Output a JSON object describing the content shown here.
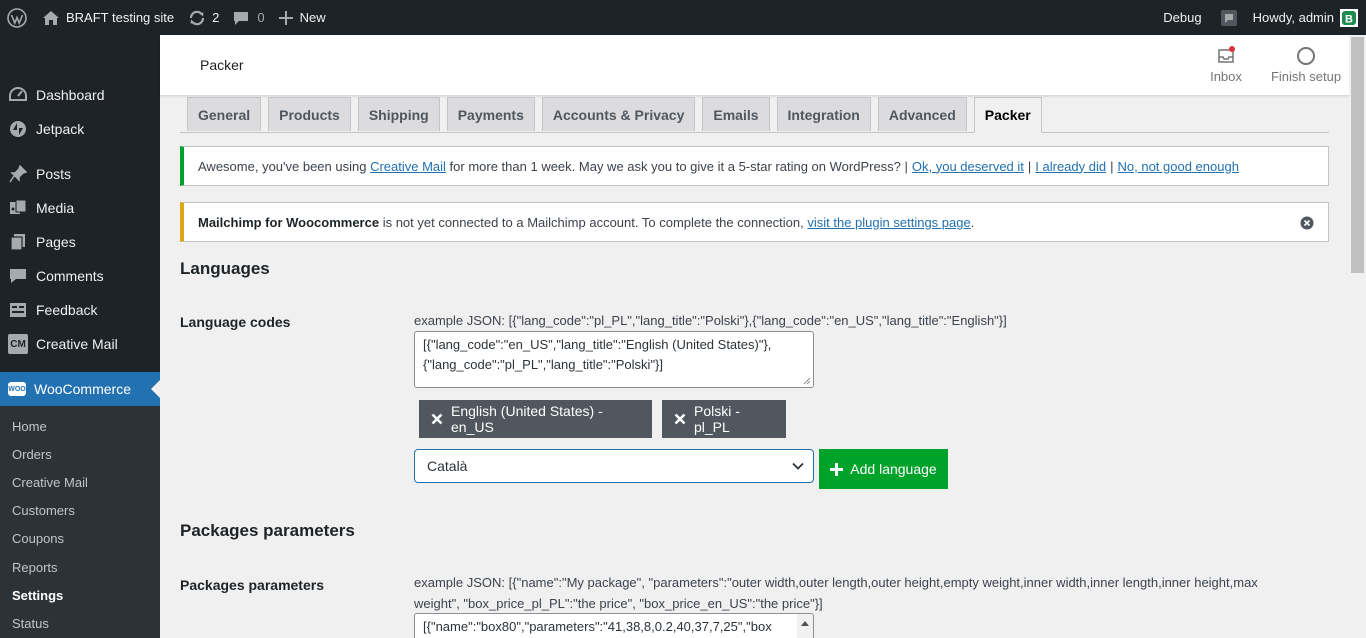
{
  "adminbar": {
    "site_name": "BRAFT testing site",
    "updates_count": "2",
    "comments_count": "0",
    "new_label": "New",
    "debug_label": "Debug",
    "howdy_label": "Howdy, admin"
  },
  "sidebar": {
    "items": [
      {
        "label": "Dashboard",
        "icon": "dashboard-icon"
      },
      {
        "label": "Jetpack",
        "icon": "jetpack-icon"
      },
      {
        "label": "Posts",
        "icon": "pin-icon"
      },
      {
        "label": "Media",
        "icon": "media-icon"
      },
      {
        "label": "Pages",
        "icon": "pages-icon"
      },
      {
        "label": "Comments",
        "icon": "comment-icon"
      },
      {
        "label": "Feedback",
        "icon": "feedback-icon"
      },
      {
        "label": "Creative Mail",
        "icon": "cm-icon",
        "badge": "CM"
      },
      {
        "label": "WooCommerce",
        "icon": "woo-icon",
        "badge": "WOO"
      }
    ],
    "submenu": [
      "Home",
      "Orders",
      "Creative Mail",
      "Customers",
      "Coupons",
      "Reports",
      "Settings",
      "Status"
    ]
  },
  "header": {
    "title": "Packer",
    "inbox_label": "Inbox",
    "finish_setup_label": "Finish setup"
  },
  "tabs": [
    "General",
    "Products",
    "Shipping",
    "Payments",
    "Accounts & Privacy",
    "Emails",
    "Integration",
    "Advanced",
    "Packer"
  ],
  "notices": {
    "creative_mail": {
      "text_before": "Awesome, you've been using ",
      "link": "Creative Mail",
      "text_after": " for more than 1 week. May we ask you to give it a 5-star rating on WordPress? |",
      "option1": "Ok, you deserved it",
      "option2": "I already did",
      "option3": "No, not good enough"
    },
    "mailchimp": {
      "bold": "Mailchimp for Woocommerce",
      "text": " is not yet connected to a Mailchimp account. To complete the connection, ",
      "link": "visit the plugin settings page",
      "text_end": "."
    }
  },
  "languages": {
    "heading": "Languages",
    "label": "Language codes",
    "example": "example JSON: [{\"lang_code\":\"pl_PL\",\"lang_title\":\"Polski\"},{\"lang_code\":\"en_US\",\"lang_title\":\"English\"}]",
    "textarea_line1": "[{\"lang_code\":\"en_US\",\"lang_title\":\"English (United States)\"},",
    "textarea_line2": "{\"lang_code\":\"pl_PL\",\"lang_title\":\"Polski\"}]",
    "chips": [
      "English (United States) - en_US",
      "Polski - pl_PL"
    ],
    "select_value": "Català",
    "add_button": "Add language"
  },
  "packages": {
    "heading": "Packages parameters",
    "label": "Packages parameters",
    "example_line1": "example JSON: [{\"name\":\"My package\", \"parameters\":\"outer width,outer length,outer height,empty weight,inner width,inner length,inner height,max",
    "example_line2": "weight\", \"box_price_pl_PL\":\"the price\", \"box_price_en_US\":\"the price\"}]",
    "textarea_value": "[{\"name\":\"box80\",\"parameters\":\"41,38,8,0.2,40,37,7,25\",\"box"
  },
  "colors": {
    "adminbar_bg": "#1d2327",
    "accent": "#2271b1",
    "success": "#00a32a",
    "warning": "#dba617"
  }
}
